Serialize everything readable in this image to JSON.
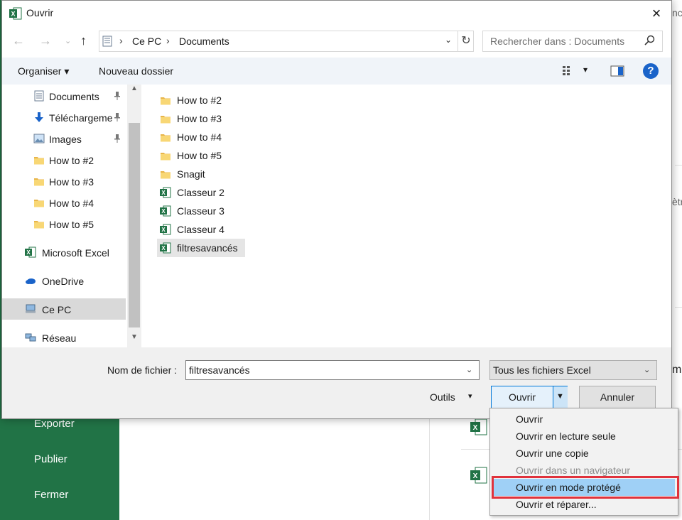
{
  "background": {
    "nav": [
      "Exporter",
      "Publier",
      "Fermer"
    ],
    "peek_top": "ncé",
    "peek_mid1": "ètre",
    "peek_mid2": "ma"
  },
  "dialog": {
    "title": "Ouvrir",
    "address": {
      "crumbs": [
        "Ce PC",
        "Documents"
      ]
    },
    "search_placeholder": "Rechercher dans : Documents",
    "toolbar": {
      "organiser": "Organiser",
      "organiser_arrow": "▾",
      "nouveau_dossier": "Nouveau dossier",
      "view_arrow": "▾",
      "help": "?"
    },
    "nav_items": [
      {
        "label": "Documents",
        "icon": "documents-icon",
        "pinned": true
      },
      {
        "label": "Téléchargements",
        "icon": "downloads-icon",
        "pinned": true
      },
      {
        "label": "Images",
        "icon": "images-icon",
        "pinned": true
      },
      {
        "label": "How to #2",
        "icon": "folder-icon"
      },
      {
        "label": "How to #3",
        "icon": "folder-icon"
      },
      {
        "label": "How to #4",
        "icon": "folder-icon"
      },
      {
        "label": "How to #5",
        "icon": "folder-icon"
      },
      {
        "label": "Microsoft Excel",
        "icon": "excel-icon"
      },
      {
        "label": "OneDrive",
        "icon": "onedrive-icon"
      },
      {
        "label": "Ce PC",
        "icon": "computer-icon",
        "selected": true
      },
      {
        "label": "Réseau",
        "icon": "network-icon"
      }
    ],
    "files": [
      {
        "name": "How to #2",
        "type": "folder"
      },
      {
        "name": "How to #3",
        "type": "folder"
      },
      {
        "name": "How to #4",
        "type": "folder"
      },
      {
        "name": "How to #5",
        "type": "folder"
      },
      {
        "name": "Snagit",
        "type": "folder"
      },
      {
        "name": "Classeur 2",
        "type": "excel"
      },
      {
        "name": "Classeur 3",
        "type": "excel"
      },
      {
        "name": "Classeur 4",
        "type": "excel"
      },
      {
        "name": "filtresavancés",
        "type": "excel",
        "selected": true
      }
    ],
    "filename_label": "Nom de fichier :",
    "filename_value": "filtresavancés",
    "filetype_value": "Tous les fichiers Excel",
    "tools_label": "Outils",
    "tools_arrow": "▾",
    "open_label": "Ouvrir",
    "cancel_label": "Annuler"
  },
  "open_menu": [
    {
      "label": "Ouvrir"
    },
    {
      "label": "Ouvrir en lecture seule"
    },
    {
      "label": "Ouvrir une copie"
    },
    {
      "label": "Ouvrir dans un navigateur",
      "disabled": true
    },
    {
      "label": "Ouvrir en mode protégé",
      "highlighted": true
    },
    {
      "label": "Ouvrir et réparer..."
    }
  ],
  "colors": {
    "excel_green": "#217346",
    "accent_blue": "#0078d7",
    "highlight_red": "#e0323c",
    "menu_highlight": "#9fd0f6"
  }
}
